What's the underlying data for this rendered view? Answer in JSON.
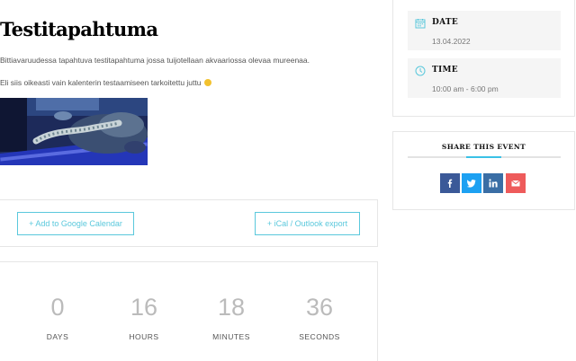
{
  "event": {
    "title": "Testitapahtuma",
    "description_1": "Bittiavaruudessa tapahtuva testitapahtuma jossa tuijotellaan akvaariossa olevaa mureenaa.",
    "description_2": "Eli siis oikeasti vain kalenterin testaamiseen tarkoitettu juttu"
  },
  "calendar_buttons": {
    "google": "+ Add to Google Calendar",
    "ical": "+ iCal / Outlook export"
  },
  "countdown": [
    {
      "value": "0",
      "label": "DAYS"
    },
    {
      "value": "16",
      "label": "HOURS"
    },
    {
      "value": "18",
      "label": "MINUTES"
    },
    {
      "value": "36",
      "label": "SECONDS"
    }
  ],
  "details": {
    "date_title": "DATE",
    "date_value": "13.04.2022",
    "time_title": "TIME",
    "time_value": "10:00 am - 6:00 pm"
  },
  "share": {
    "title": "SHARE THIS EVENT",
    "icons": [
      "facebook-icon",
      "twitter-icon",
      "linkedin-icon",
      "email-icon"
    ]
  },
  "colors": {
    "accent": "#5ac8dc",
    "facebook": "#3b5998",
    "twitter": "#1da1f2",
    "linkedin": "#3a6ea5",
    "email": "#ee5b5b"
  }
}
